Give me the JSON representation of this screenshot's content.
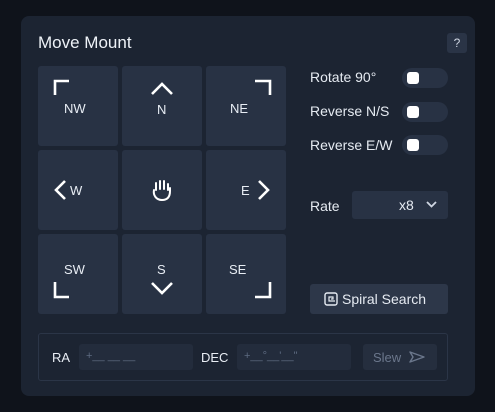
{
  "panel": {
    "title": "Move Mount",
    "help_label": "?"
  },
  "pads": {
    "nw": "NW",
    "n": "N",
    "ne": "NE",
    "w": "W",
    "e": "E",
    "sw": "SW",
    "s": "S",
    "se": "SE"
  },
  "options": {
    "rotate_90": {
      "label": "Rotate 90°",
      "on": false
    },
    "reverse_ns": {
      "label": "Reverse N/S",
      "on": false
    },
    "reverse_ew": {
      "label": "Reverse E/W",
      "on": false
    }
  },
  "rate": {
    "label": "Rate",
    "value": "x8"
  },
  "spiral_search": {
    "label": "Spiral Search"
  },
  "coords": {
    "ra_label": "RA",
    "ra_placeholder": "+__ __ __",
    "dec_label": "DEC",
    "dec_placeholder": "+__°__'__\"",
    "slew_label": "Slew"
  },
  "colors": {
    "panel": "#1c2432",
    "pad": "#283244",
    "text": "#e6ebf2",
    "disabled": "#6b778c"
  }
}
